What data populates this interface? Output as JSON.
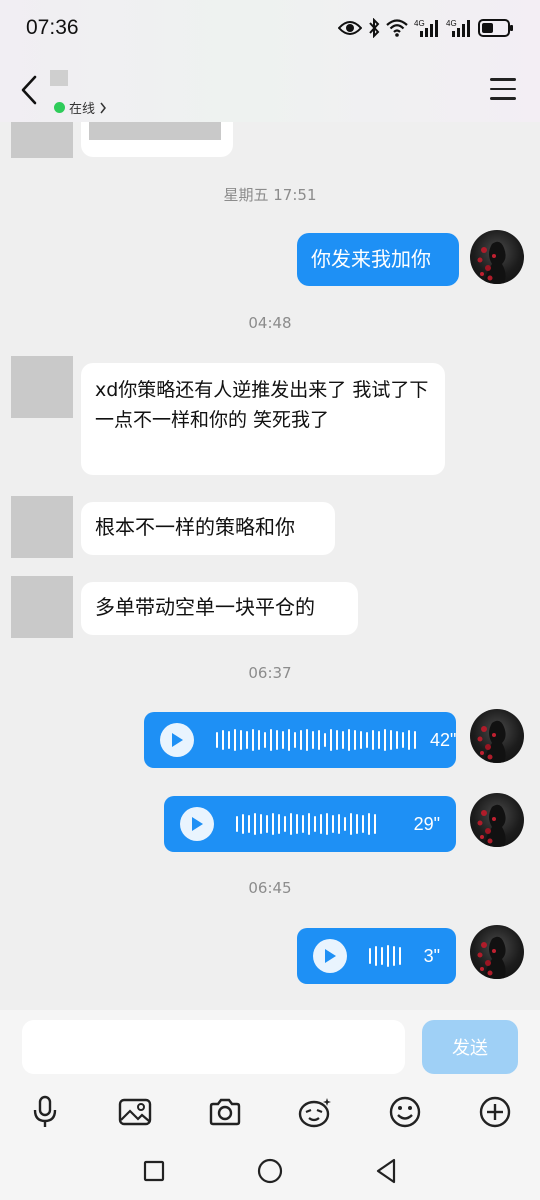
{
  "status": {
    "time": "07:36",
    "icons": [
      "eye-icon",
      "bluetooth-icon",
      "wifi-icon",
      "signal-4g-icon",
      "signal-4g-icon",
      "battery-icon"
    ],
    "net1": "4G",
    "net2": "4G"
  },
  "header": {
    "status_text": "在线",
    "status_color": "#2ecc5a"
  },
  "messages": {
    "time1": "星期五 17:51",
    "out1": "你发来我加你",
    "time2": "04:48",
    "in1": "xd你策略还有人逆推发出来了 我试了下 一点不一样和你的 笑死我了",
    "in2": "根本不一样的策略和你",
    "in3": "多单带动空单一块平仓的",
    "time3": "06:37",
    "voice1": "42\"",
    "voice2": "29\"",
    "time4": "06:45",
    "voice3": "3\""
  },
  "input": {
    "placeholder": "",
    "send_label": "发送"
  },
  "toolbar": [
    "microphone-icon",
    "image-icon",
    "camera-icon",
    "sticker-icon",
    "emoji-icon",
    "plus-icon"
  ],
  "colors": {
    "bubble_out": "#1e90f5",
    "send_disabled": "#9fd0f6"
  }
}
